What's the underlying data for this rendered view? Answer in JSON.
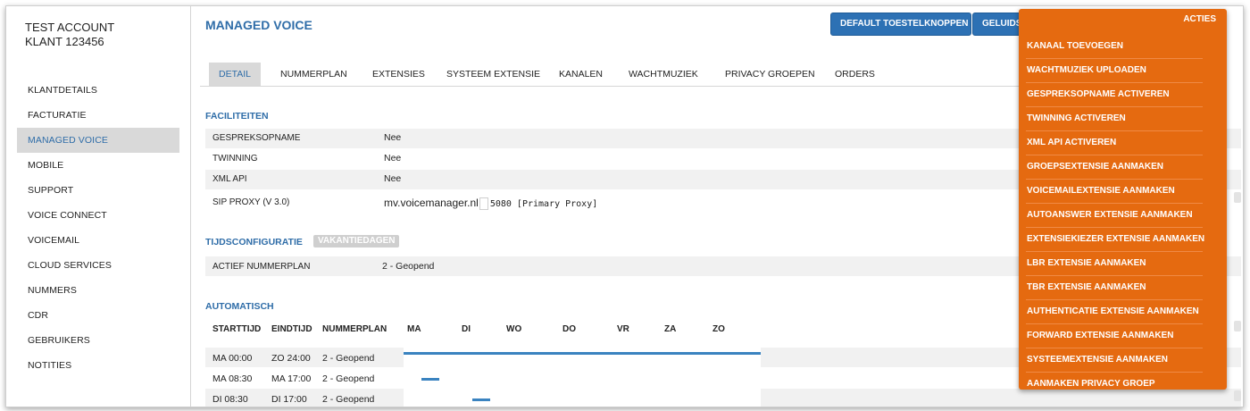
{
  "account": {
    "line1": "TEST ACCOUNT",
    "line2": "KLANT 123456"
  },
  "sidebar": {
    "items": [
      {
        "label": "KLANTDETAILS",
        "active": false
      },
      {
        "label": "FACTURATIE",
        "active": false
      },
      {
        "label": "MANAGED VOICE",
        "active": true
      },
      {
        "label": "MOBILE",
        "active": false
      },
      {
        "label": "SUPPORT",
        "active": false
      },
      {
        "label": "VOICE CONNECT",
        "active": false
      },
      {
        "label": "VOICEMAIL",
        "active": false
      },
      {
        "label": "CLOUD SERVICES",
        "active": false
      },
      {
        "label": "NUMMERS",
        "active": false
      },
      {
        "label": "CDR",
        "active": false
      },
      {
        "label": "GEBRUIKERS",
        "active": false
      },
      {
        "label": "NOTITIES",
        "active": false
      }
    ]
  },
  "header": {
    "title": "MANAGED VOICE",
    "btn_default": "DEFAULT TOESTELKNOPPEN",
    "btn_geluid": "GELUIDS"
  },
  "tabs": [
    {
      "label": "DETAIL",
      "active": true
    },
    {
      "label": "NUMMERPLAN",
      "active": false
    },
    {
      "label": "EXTENSIES",
      "active": false
    },
    {
      "label": "SYSTEEM EXTENSIE",
      "active": false
    },
    {
      "label": "KANALEN",
      "active": false
    },
    {
      "label": "WACHTMUZIEK",
      "active": false
    },
    {
      "label": "PRIVACY GROEPEN",
      "active": false
    },
    {
      "label": "ORDERS",
      "active": false
    }
  ],
  "faciliteiten": {
    "title": "FACILITEITEN",
    "rows": [
      {
        "label": "GESPREKSOPNAME",
        "value": "Nee"
      },
      {
        "label": "TWINNING",
        "value": "Nee"
      },
      {
        "label": "XML API",
        "value": "Nee"
      },
      {
        "label": "SIP PROXY (V 3.0)",
        "host": "mv.voicemanager.nl",
        "rest": "5080 [Primary Proxy]"
      }
    ]
  },
  "tijd": {
    "title": "TIJDSCONFIGURATIE",
    "badge": "VAKANTIEDAGEN",
    "row": {
      "label": "ACTIEF NUMMERPLAN",
      "value": "2 - Geopend"
    }
  },
  "automatisch": {
    "title": "AUTOMATISCH",
    "headers": {
      "start": "STARTTIJD",
      "end": "EINDTIJD",
      "plan": "NUMMERPLAN"
    },
    "days": [
      "MA",
      "DI",
      "WO",
      "DO",
      "VR",
      "ZA",
      "ZO"
    ],
    "rows": [
      {
        "start": "MA 00:00",
        "end": "ZO 24:00",
        "plan": "2 - Geopend",
        "from": 0.0,
        "to": 1.0
      },
      {
        "start": "MA 08:30",
        "end": "MA 17:00",
        "plan": "2 - Geopend",
        "from": 0.05,
        "to": 0.1
      },
      {
        "start": "DI 08:30",
        "end": "DI 17:00",
        "plan": "2 - Geopend",
        "from": 0.193,
        "to": 0.243
      }
    ]
  },
  "actions": {
    "title": "ACTIES",
    "items": [
      "KANAAL TOEVOEGEN",
      "WACHTMUZIEK UPLOADEN",
      "GESPREKSOPNAME ACTIVEREN",
      "TWINNING ACTIVEREN",
      "XML API ACTIVEREN",
      "GROEPSEXTENSIE AANMAKEN",
      "VOICEMAILEXTENSIE AANMAKEN",
      "AUTOANSWER EXTENSIE AANMAKEN",
      "EXTENSIEKIEZER EXTENSIE AANMAKEN",
      "LBR EXTENSIE AANMAKEN",
      "TBR EXTENSIE AANMAKEN",
      "AUTHENTICATIE EXTENSIE AANMAKEN",
      "FORWARD EXTENSIE AANMAKEN",
      "SYSTEEMEXTENSIE AANMAKEN",
      "AANMAKEN PRIVACY GROEP"
    ]
  },
  "colors": {
    "accent": "#2f6da8",
    "button": "#2d71b4",
    "actions_bg": "#e56a10",
    "timeline": "#3a83c0"
  }
}
